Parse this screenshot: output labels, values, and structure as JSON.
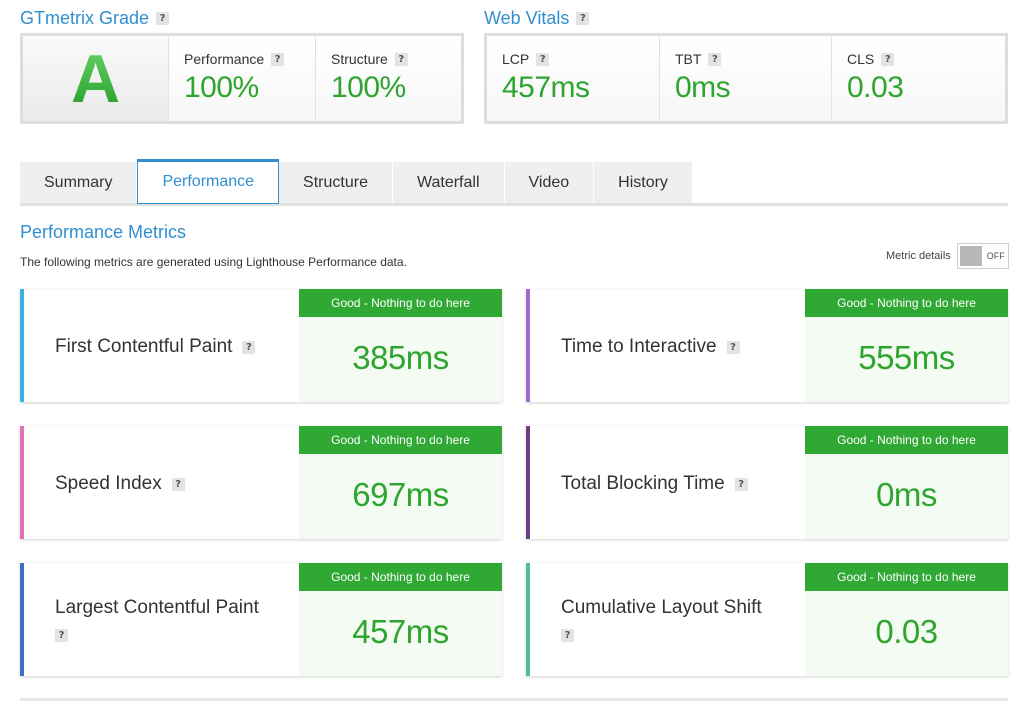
{
  "grade_section": {
    "title": "GTmetrix Grade",
    "grade": "A",
    "performance_label": "Performance",
    "performance_value": "100%",
    "structure_label": "Structure",
    "structure_value": "100%"
  },
  "vitals_section": {
    "title": "Web Vitals",
    "lcp_label": "LCP",
    "lcp_value": "457ms",
    "tbt_label": "TBT",
    "tbt_value": "0ms",
    "cls_label": "CLS",
    "cls_value": "0.03"
  },
  "help_glyph": "?",
  "tabs": [
    {
      "label": "Summary",
      "active": false
    },
    {
      "label": "Performance",
      "active": true
    },
    {
      "label": "Structure",
      "active": false
    },
    {
      "label": "Waterfall",
      "active": false
    },
    {
      "label": "Video",
      "active": false
    },
    {
      "label": "History",
      "active": false
    }
  ],
  "performance_metrics": {
    "title": "Performance Metrics",
    "description": "The following metrics are generated using Lighthouse Performance data.",
    "toggle_label": "Metric details",
    "toggle_state": "OFF"
  },
  "metrics": [
    {
      "name": "First Contentful Paint",
      "status": "Good - Nothing to do here",
      "value": "385ms",
      "color": "#3db2e6"
    },
    {
      "name": "Time to Interactive",
      "status": "Good - Nothing to do here",
      "value": "555ms",
      "color": "#a26bc7"
    },
    {
      "name": "Speed Index",
      "status": "Good - Nothing to do here",
      "value": "697ms",
      "color": "#e56fb4"
    },
    {
      "name": "Total Blocking Time",
      "status": "Good - Nothing to do here",
      "value": "0ms",
      "color": "#6b3f82"
    },
    {
      "name": "Largest Contentful Paint",
      "status": "Good - Nothing to do here",
      "value": "457ms",
      "color": "#3f6fc4"
    },
    {
      "name": "Cumulative Layout Shift",
      "status": "Good - Nothing to do here",
      "value": "0.03",
      "color": "#4fbf95"
    }
  ],
  "colors": {
    "accent_blue": "#2f8fd0",
    "good_green": "#2ea52e",
    "status_green": "#30a834"
  }
}
